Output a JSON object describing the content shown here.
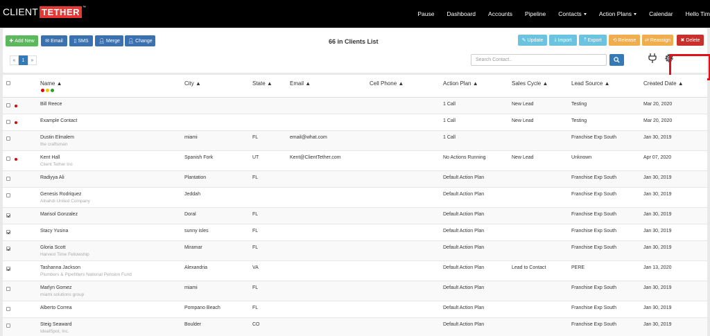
{
  "logo": {
    "part1": "CLIENT",
    "part2": "TETHER",
    "tm": "™"
  },
  "nav": {
    "items": [
      {
        "label": "Pause",
        "caret": false
      },
      {
        "label": "Dashboard",
        "caret": false
      },
      {
        "label": "Accounts",
        "caret": false
      },
      {
        "label": "Pipeline",
        "caret": false
      },
      {
        "label": "Contacts",
        "caret": true
      },
      {
        "label": "Action Plans",
        "caret": true
      },
      {
        "label": "Calendar",
        "caret": false
      },
      {
        "label": "Hello Tim",
        "caret": false
      }
    ]
  },
  "toolbar": {
    "add_new": "Add New",
    "email": "Email",
    "sms": "SMS",
    "merge": "Merge",
    "change": "Change",
    "list_title": "66 in Clients List",
    "update": "Update",
    "import": "Import",
    "export": "Export",
    "release": "Release",
    "reassign": "Reassign",
    "delete": "Delete"
  },
  "pager": {
    "prev": "«",
    "current": "1",
    "next": "»"
  },
  "search": {
    "placeholder": "Search Contact.."
  },
  "status_dot_colors": {
    "red": "#e00000",
    "yellow": "#f2c200",
    "green": "#2a9d2a"
  },
  "columns": {
    "name": "Name ▲",
    "city": "City ▲",
    "state": "State ▲",
    "email": "Email ▲",
    "cell_phone": "Cell Phone ▲",
    "action_plan": "Action Plan ▲",
    "sales_cycle": "Sales Cycle ▲",
    "lead_source": "Lead Source ▲",
    "created_date": "Created Date ▲"
  },
  "rows": [
    {
      "name": "Bill Reece",
      "company": "",
      "city": "",
      "state": "",
      "email": "",
      "action_plan": "1 Call",
      "sales_cycle": "New Lead",
      "lead_source": "Testing",
      "created": "Mar 20, 2020",
      "checked": false,
      "dot": true
    },
    {
      "name": "Example Contact",
      "company": "",
      "city": "",
      "state": "",
      "email": "",
      "action_plan": "1 Call",
      "sales_cycle": "New Lead",
      "lead_source": "Testing",
      "created": "Mar 20, 2020",
      "checked": false,
      "dot": true
    },
    {
      "name": "Dustin Elmalem",
      "company": "the craftsman",
      "city": "miami",
      "state": "FL",
      "email": "email@what.com",
      "action_plan": "1 Call",
      "sales_cycle": "",
      "lead_source": "Franchise Exp South",
      "created": "Jan 30, 2019",
      "checked": false,
      "dot": false
    },
    {
      "name": "Kent Hall",
      "company": "Client Tether Inc",
      "city": "Spanish Fork",
      "state": "UT",
      "email": "Kent@ClientTether.com",
      "action_plan": "No Actions Running",
      "sales_cycle": "New Lead",
      "lead_source": "Unknown",
      "created": "Apr 07, 2020",
      "checked": false,
      "dot": true
    },
    {
      "name": "Radiyya Ali",
      "company": "",
      "city": "Plantation",
      "state": "FL",
      "email": "",
      "action_plan": "Default Action Plan",
      "sales_cycle": "",
      "lead_source": "Franchise Exp South",
      "created": "Jan 30, 2019",
      "checked": false,
      "dot": false
    },
    {
      "name": "Genesis Rodriquez",
      "company": "Alnahdi United Company",
      "city": "Jeddah",
      "state": "",
      "email": "",
      "action_plan": "Default Action Plan",
      "sales_cycle": "",
      "lead_source": "Franchise Exp South",
      "created": "Jan 30, 2019",
      "checked": false,
      "dot": false
    },
    {
      "name": "Marisol Gonzalez",
      "company": "",
      "city": "Doral",
      "state": "FL",
      "email": "",
      "action_plan": "Default Action Plan",
      "sales_cycle": "",
      "lead_source": "Franchise Exp South",
      "created": "Jan 30, 2019",
      "checked": true,
      "dot": false
    },
    {
      "name": "Stacy Yusina",
      "company": "",
      "city": "sunny isles",
      "state": "FL",
      "email": "",
      "action_plan": "Default Action Plan",
      "sales_cycle": "",
      "lead_source": "Franchise Exp South",
      "created": "Jan 30, 2019",
      "checked": true,
      "dot": false
    },
    {
      "name": "Gloria Scott",
      "company": "Harvest Time Fellowship",
      "city": "Miramar",
      "state": "FL",
      "email": "",
      "action_plan": "Default Action Plan",
      "sales_cycle": "",
      "lead_source": "Franchise Exp South",
      "created": "Jan 30, 2019",
      "checked": true,
      "dot": false
    },
    {
      "name": "Tashanna Jackson",
      "company": "Plumbers & Pipefitters National Pension Fund",
      "city": "Alexandria",
      "state": "VA",
      "email": "",
      "action_plan": "Default Action Plan",
      "sales_cycle": "Lead to Contact",
      "lead_source": "PERE",
      "created": "Jan 13, 2020",
      "checked": true,
      "dot": false
    },
    {
      "name": "Marlyn Gomez",
      "company": "miami solutions group",
      "city": "miami",
      "state": "FL",
      "email": "",
      "action_plan": "Default Action Plan",
      "sales_cycle": "",
      "lead_source": "Franchise Exp South",
      "created": "Jan 30, 2019",
      "checked": false,
      "dot": false
    },
    {
      "name": "Alberto Correa",
      "company": "",
      "city": "Pompano Beach",
      "state": "FL",
      "email": "",
      "action_plan": "Default Action Plan",
      "sales_cycle": "",
      "lead_source": "Franchise Exp South",
      "created": "Jan 30, 2019",
      "checked": false,
      "dot": false
    },
    {
      "name": "Steig Seaward",
      "company": "IdealSpot, Inc.",
      "city": "Boulder",
      "state": "CO",
      "email": "",
      "action_plan": "Default Action Plan",
      "sales_cycle": "",
      "lead_source": "Franchise Exp South",
      "created": "Jan 30, 2019",
      "checked": false,
      "dot": false
    }
  ]
}
